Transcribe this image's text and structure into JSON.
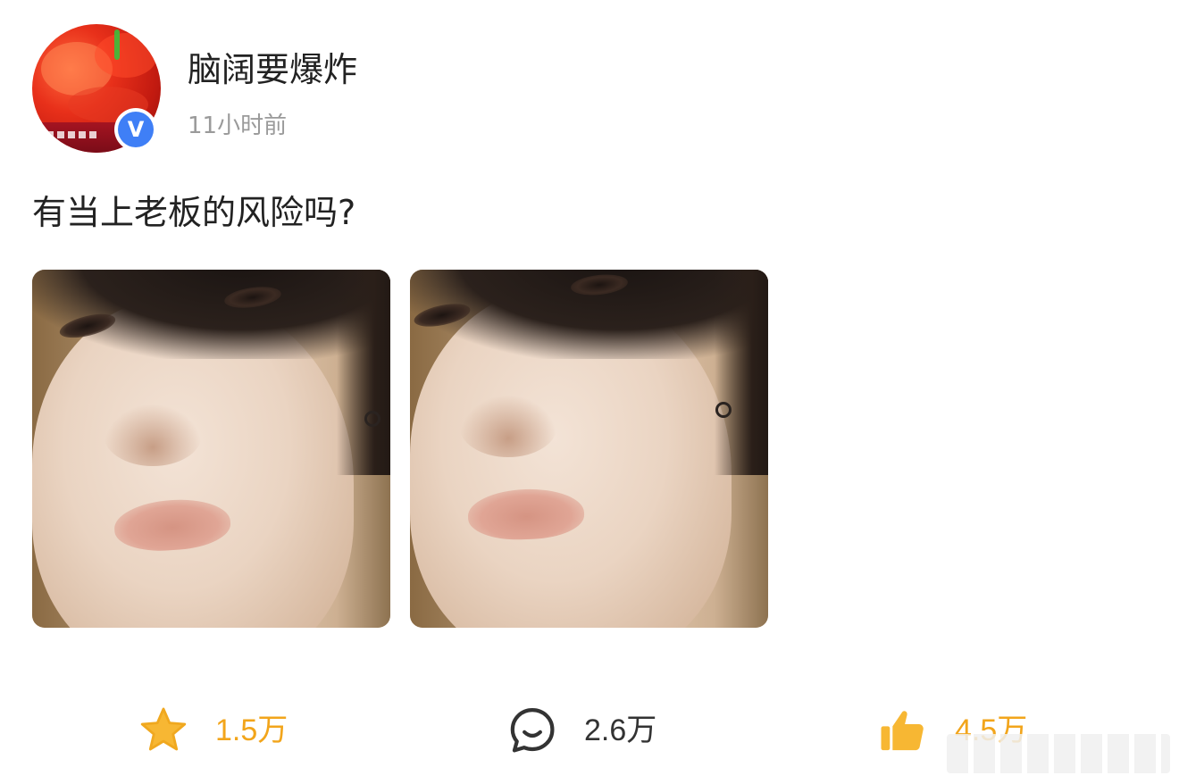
{
  "post": {
    "author": {
      "name": "脑阔要爆炸",
      "verified_badge": "V",
      "avatar_icon": "avatar-red-hair"
    },
    "time": "11小时前",
    "text": "有当上老板的风险吗?",
    "images": [
      {
        "alt": "photo-1"
      },
      {
        "alt": "photo-2"
      }
    ]
  },
  "actions": {
    "favorite": {
      "icon": "star-icon",
      "count": "1.5万",
      "color": "#f2a51b"
    },
    "comment": {
      "icon": "comment-icon",
      "count": "2.6万",
      "color": "#333333"
    },
    "like": {
      "icon": "thumbs-up-icon",
      "count": "4.5万",
      "color": "#f2a51b"
    }
  },
  "colors": {
    "verified": "#3f7ff6",
    "time_text": "#9a9a9a",
    "accent": "#f2a51b"
  }
}
